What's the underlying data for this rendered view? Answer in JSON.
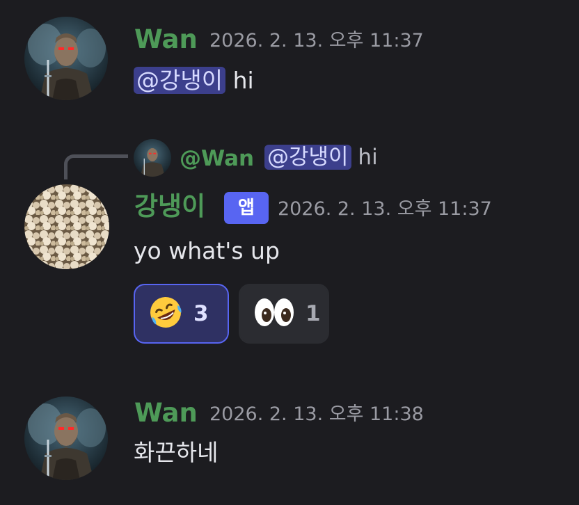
{
  "messages": [
    {
      "author": "Wan",
      "timestamp": "2026. 2. 13. 오후 11:37",
      "mention": "@강냉이",
      "text": " hi"
    },
    {
      "reply": {
        "author": "@Wan",
        "mention": "@강냉이",
        "text": " hi"
      },
      "author": "강냉이",
      "badge": "앱",
      "timestamp": "2026. 2. 13. 오후 11:37",
      "text": "yo what's up",
      "reactions": [
        {
          "emoji_icon": "rolling-on-floor-laughing-emoji",
          "count": "3",
          "active": true
        },
        {
          "emoji_icon": "eyes-emoji",
          "count": "1",
          "active": false
        }
      ]
    },
    {
      "author": "Wan",
      "timestamp": "2026. 2. 13. 오후 11:38",
      "text": "화끈하네"
    }
  ],
  "colors": {
    "background": "#1c1c20",
    "author_green": "#4e9a58",
    "mention_bg": "#3c3f8c",
    "badge_blue": "#5865f2",
    "timestamp_gray": "#9a9ba3"
  }
}
